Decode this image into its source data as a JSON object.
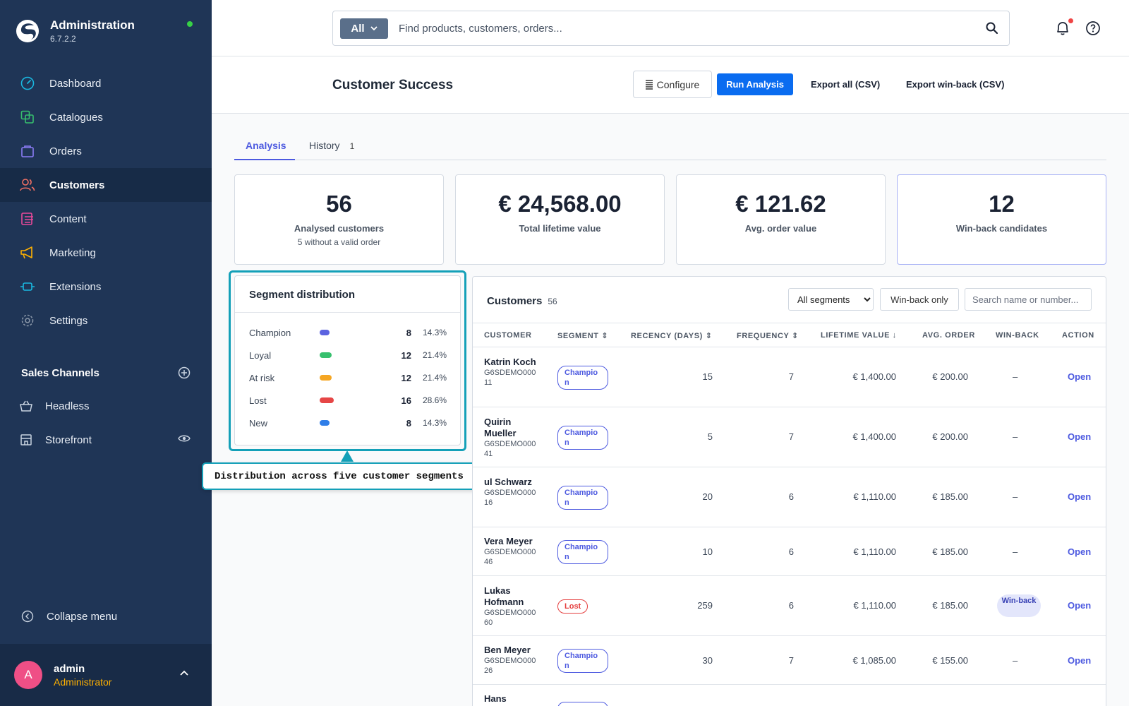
{
  "app": {
    "title": "Administration",
    "version": "6.7.2.2"
  },
  "sidebar": {
    "items": [
      {
        "label": "Dashboard",
        "icon": "dashboard-icon"
      },
      {
        "label": "Catalogues",
        "icon": "catalogue-icon"
      },
      {
        "label": "Orders",
        "icon": "bag-icon"
      },
      {
        "label": "Customers",
        "icon": "users-icon"
      },
      {
        "label": "Content",
        "icon": "content-icon"
      },
      {
        "label": "Marketing",
        "icon": "megaphone-icon"
      },
      {
        "label": "Extensions",
        "icon": "plug-icon"
      },
      {
        "label": "Settings",
        "icon": "gear-icon"
      }
    ],
    "sales_channels_title": "Sales Channels",
    "sales_channels": [
      {
        "label": "Headless",
        "icon": "basket-icon"
      },
      {
        "label": "Storefront",
        "icon": "storefront-icon"
      }
    ],
    "collapse_label": "Collapse menu",
    "user": {
      "initial": "A",
      "name": "admin",
      "role": "Administrator"
    }
  },
  "topbar": {
    "search_filter": "All",
    "search_placeholder": "Find products, customers, orders..."
  },
  "header": {
    "title": "Customer Success",
    "configure_label": "Configure",
    "run_label": "Run Analysis",
    "export_all_label": "Export all (CSV)",
    "export_winback_label": "Export win-back (CSV)"
  },
  "tabs": {
    "analysis": "Analysis",
    "history": "History",
    "history_count": "1"
  },
  "kpis": [
    {
      "value": "56",
      "label": "Analysed customers",
      "sub": "5 without a valid order"
    },
    {
      "value": "€ 24,568.00",
      "label": "Total lifetime value"
    },
    {
      "value": "€ 121.62",
      "label": "Avg. order value"
    },
    {
      "value": "12",
      "label": "Win-back candidates"
    }
  ],
  "segments": {
    "title": "Segment distribution",
    "tooltip": "Distribution across five customer segments",
    "rows": [
      {
        "name": "Champion",
        "count": "8",
        "pct": "14.3%",
        "color": "#5b63e0",
        "share": 0.5
      },
      {
        "name": "Loyal",
        "count": "12",
        "pct": "21.4%",
        "color": "#37c06e",
        "share": 0.75
      },
      {
        "name": "At risk",
        "count": "12",
        "pct": "21.4%",
        "color": "#f5a623",
        "share": 0.75
      },
      {
        "name": "Lost",
        "count": "16",
        "pct": "28.6%",
        "color": "#e64646",
        "share": 1.0
      },
      {
        "name": "New",
        "count": "8",
        "pct": "14.3%",
        "color": "#2f7ee8",
        "share": 0.5
      }
    ]
  },
  "customers": {
    "title": "Customers",
    "count": "56",
    "segment_filter": "All segments",
    "winback_label": "Win-back only",
    "search_placeholder": "Search name or number...",
    "columns": {
      "customer": "CUSTOMER",
      "segment": "SEGMENT ⇕",
      "recency": "RECENCY (DAYS) ⇕",
      "frequency": "FREQUENCY ⇕",
      "ltv": "LIFETIME VALUE ↓",
      "avg": "AVG. ORDER",
      "winback": "WIN-BACK",
      "action": "ACTION"
    },
    "rows": [
      {
        "name": "Katrin Koch",
        "number": "G6SDEMO00011",
        "segment": "Champion",
        "recency": "15",
        "frequency": "7",
        "ltv": "€ 1,400.00",
        "avg": "€ 200.00",
        "winback": "–",
        "action": "Open"
      },
      {
        "name": "Quirin Mueller",
        "number": "G6SDEMO00041",
        "segment": "Champion",
        "recency": "5",
        "frequency": "7",
        "ltv": "€ 1,400.00",
        "avg": "€ 200.00",
        "winback": "–",
        "action": "Open"
      },
      {
        "name": "ul Schwarz",
        "number": "G6SDEMO00016",
        "segment": "Champion",
        "recency": "20",
        "frequency": "6",
        "ltv": "€ 1,110.00",
        "avg": "€ 185.00",
        "winback": "–",
        "action": "Open"
      },
      {
        "name": "Vera Meyer",
        "number": "G6SDEMO00046",
        "segment": "Champion",
        "recency": "10",
        "frequency": "6",
        "ltv": "€ 1,110.00",
        "avg": "€ 185.00",
        "winback": "–",
        "action": "Open"
      },
      {
        "name": "Lukas Hofmann",
        "number": "G6SDEMO00060",
        "segment": "Lost",
        "recency": "259",
        "frequency": "6",
        "ltv": "€ 1,110.00",
        "avg": "€ 185.00",
        "winback": "Win-back",
        "action": "Open"
      },
      {
        "name": "Ben Meyer",
        "number": "G6SDEMO00026",
        "segment": "Champion",
        "recency": "30",
        "frequency": "7",
        "ltv": "€ 1,085.00",
        "avg": "€ 155.00",
        "winback": "–",
        "action": "Open"
      },
      {
        "name": "Hans",
        "number": "",
        "segment": "Champion",
        "recency": "",
        "frequency": "",
        "ltv": "",
        "avg": "",
        "winback": "",
        "action": ""
      }
    ]
  }
}
